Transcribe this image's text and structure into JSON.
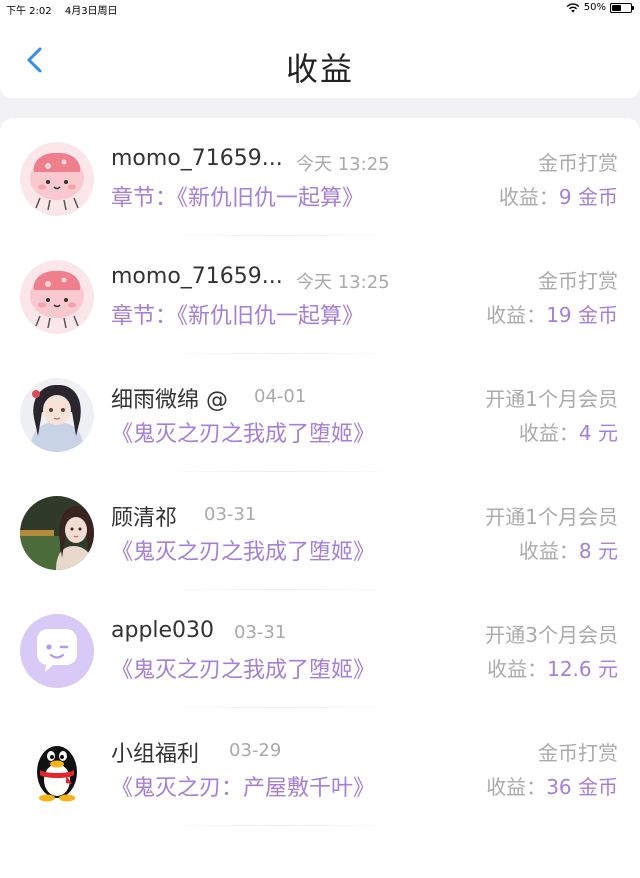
{
  "status_bar": {
    "time": "下午 2:02",
    "date": "4月3日周日",
    "battery": "50%",
    "battery_level": 0.5
  },
  "nav": {
    "title": "收益"
  },
  "earnings_label": "收益：",
  "rows": [
    {
      "name": "momo_71659...",
      "date": "今天 13:25",
      "type": "金币打赏",
      "description": "章节：《新仇旧仇一起算》",
      "amount": "9 金币",
      "avatar": "pink-blob-avatar-icon"
    },
    {
      "name": "momo_71659...",
      "date": "今天 13:25",
      "type": "金币打赏",
      "description": "章节：《新仇旧仇一起算》",
      "amount": "19 金币",
      "avatar": "pink-blob-avatar-icon"
    },
    {
      "name": "细雨微绵 @",
      "date": "04-01",
      "type": "开通1个月会员",
      "description": "《鬼灭之刃之我成了堕姬》",
      "amount": "4 元",
      "avatar": "anime-girl-avatar"
    },
    {
      "name": "顾清祁",
      "date": "03-31",
      "type": "开通1个月会员",
      "description": "《鬼灭之刃之我成了堕姬》",
      "amount": "8 元",
      "avatar": "photo-girl-avatar"
    },
    {
      "name": "apple030",
      "date": "03-31",
      "type": "开通3个月会员",
      "description": "《鬼灭之刃之我成了堕姬》",
      "amount": "12.6 元",
      "avatar": "chat-bubble-avatar-icon"
    },
    {
      "name": "小组福利",
      "date": "03-29",
      "type": "金币打赏",
      "description": "《鬼灭之刃：产屋敷千叶》",
      "amount": "36 金币",
      "avatar": "qq-penguin-avatar-icon"
    }
  ],
  "colors": {
    "accent_purple": "#a57fd8",
    "back_blue": "#2f8fe8",
    "muted_gray": "#aaaaaa",
    "background": "#f2f2f4"
  }
}
